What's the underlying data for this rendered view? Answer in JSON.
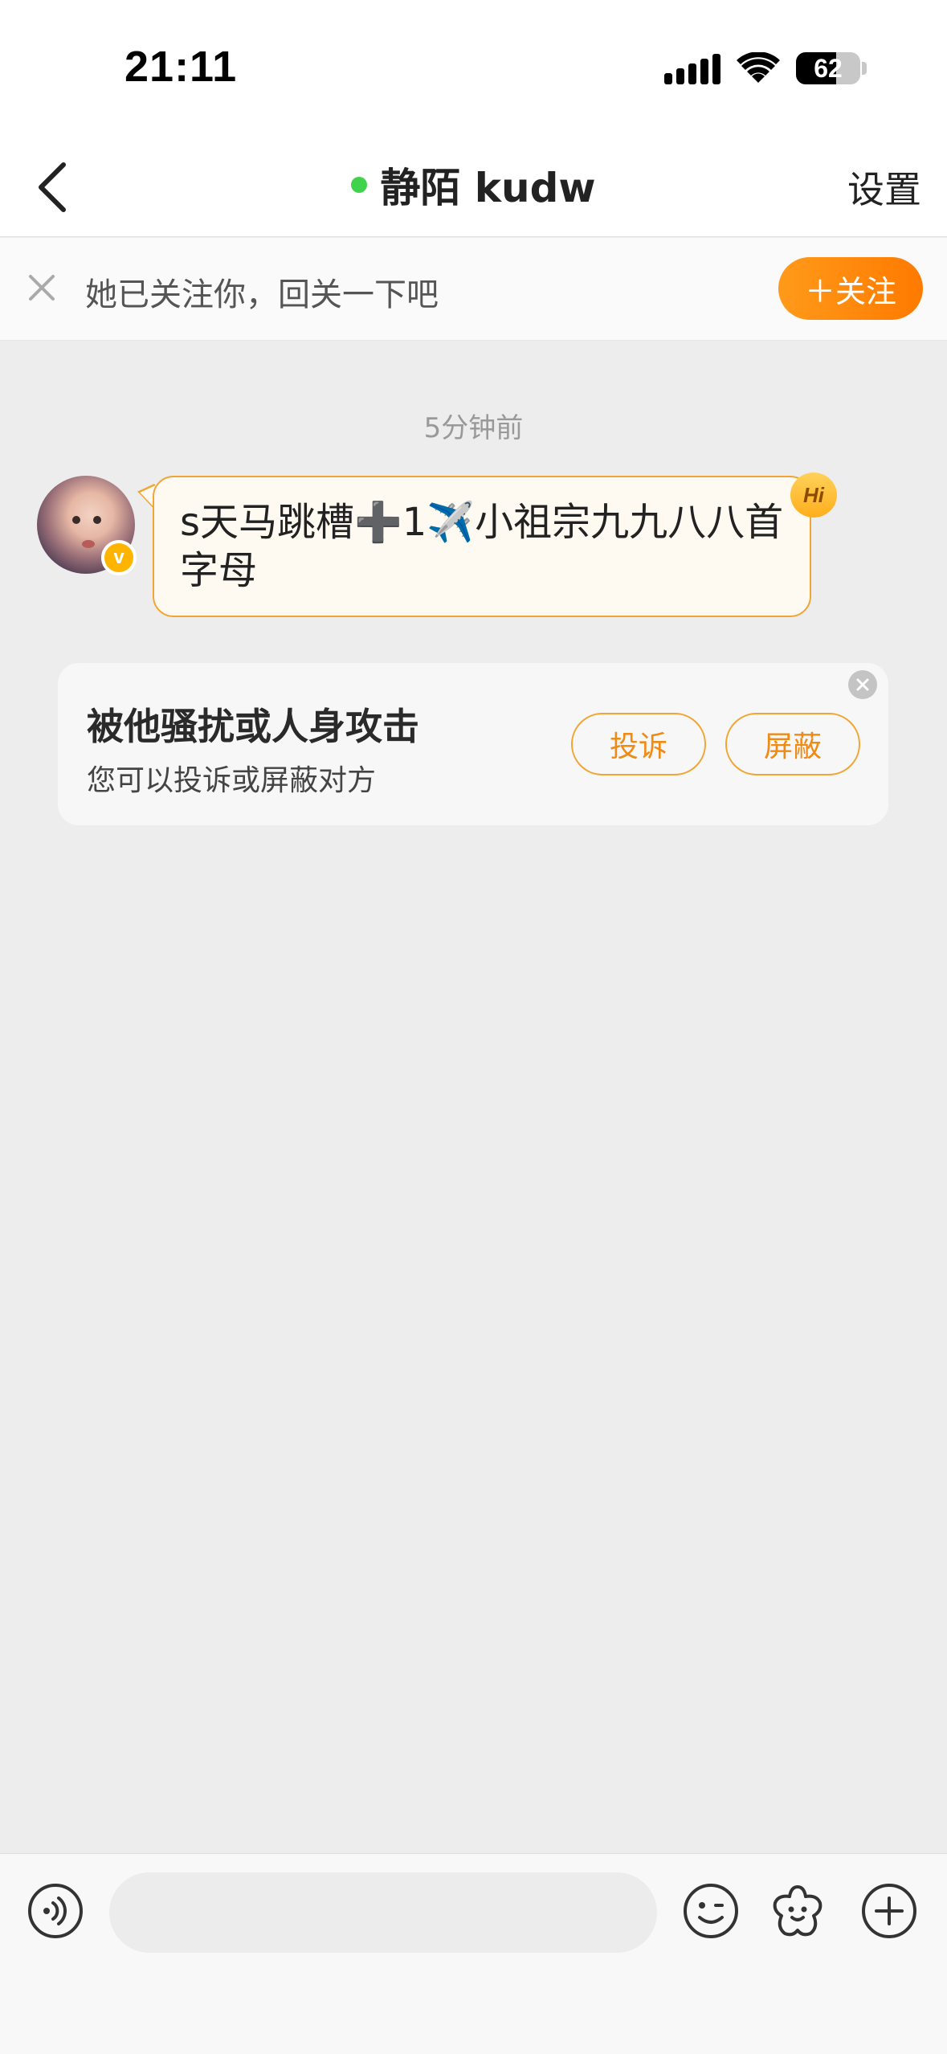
{
  "status_bar": {
    "time": "21:11",
    "battery_percent": "62",
    "battery_level": 0.62,
    "icons": [
      "signal-icon",
      "wifi-icon",
      "battery-icon"
    ]
  },
  "header": {
    "back_icon": "chevron-left-icon",
    "title": "静陌 kudw",
    "online_status_color": "#3ed34a",
    "settings_label": "设置"
  },
  "follow_banner": {
    "close_icon": "close-icon",
    "text": "她已关注你，回关一下吧",
    "follow_button_label": "＋关注",
    "accent_color": "#ff8a00"
  },
  "chat": {
    "timestamp": "5分钟前",
    "messages": [
      {
        "sender_avatar": "avatar",
        "verified_badge": "v",
        "text_part1": "s天马跳槽",
        "plus_emoji": "➕",
        "text_part2": "1",
        "plane_emoji": "✈️",
        "text_part3": "小祖宗九九八八首字母",
        "greeting_badge": "Hi"
      }
    ]
  },
  "report_card": {
    "title": "被他骚扰或人身攻击",
    "subtitle": "您可以投诉或屏蔽对方",
    "report_label": "投诉",
    "block_label": "屏蔽",
    "close_icon": "close-circle-icon"
  },
  "input_bar": {
    "placeholder": "",
    "icons": [
      "voice-icon",
      "emoji-icon",
      "sticker-icon",
      "plus-circle-icon"
    ]
  }
}
